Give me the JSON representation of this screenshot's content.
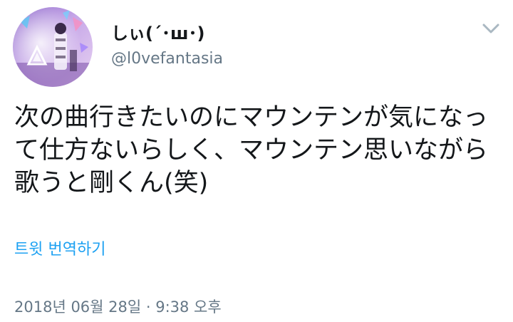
{
  "user": {
    "display_name": "しぃ(´･ш･)",
    "handle": "@l0vefantasia"
  },
  "icons": {
    "menu": "chevron-down-icon",
    "avatar": "profile-photo"
  },
  "tweet": {
    "lines": [
      "次の曲行きたいのにマウンテンが気になっ",
      "て仕方ないらしく、マウンテン思いながら",
      "歌うと剛くん(笑)"
    ],
    "translate_label": "트윗 번역하기",
    "timestamp": "2018년 06월 28일 · 9:38 오후"
  },
  "colors": {
    "text": "#14171a",
    "secondary": "#657786",
    "link": "#1da1f2",
    "chevron": "#aab8c2"
  }
}
